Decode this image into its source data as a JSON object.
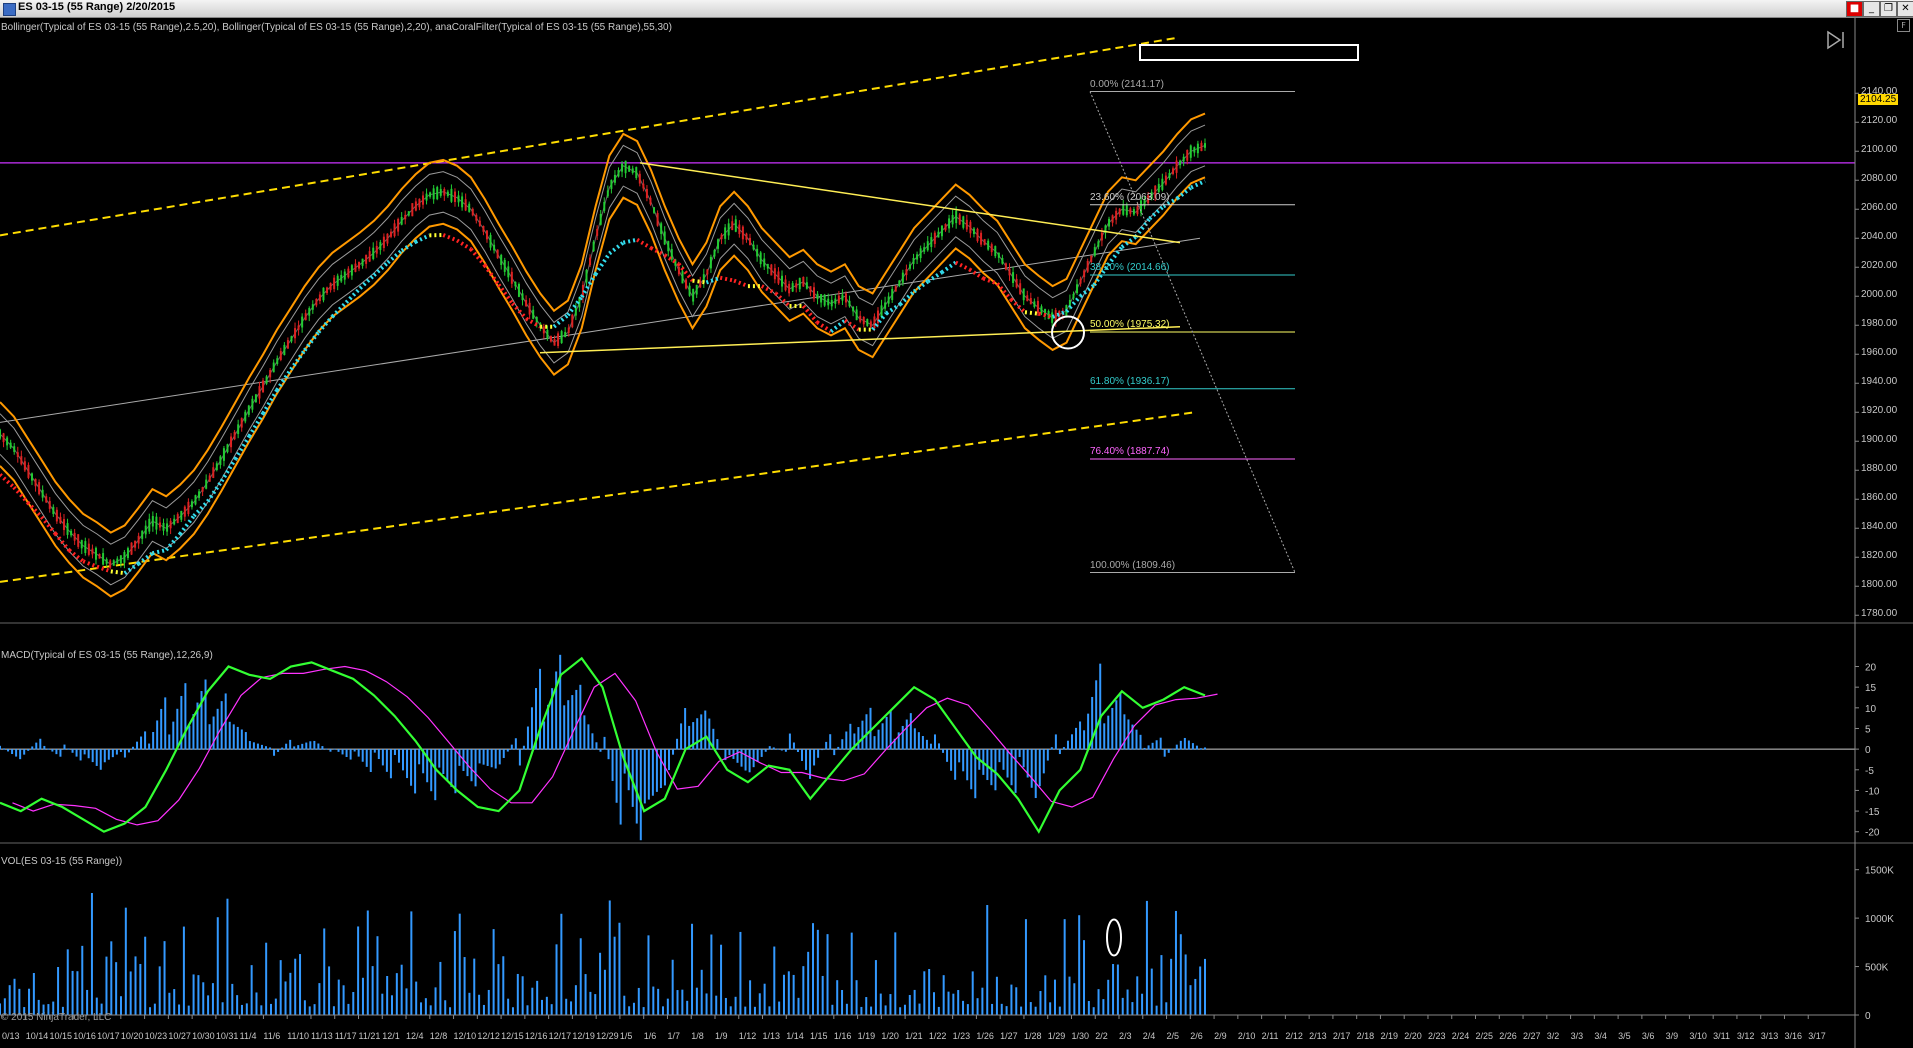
{
  "window": {
    "title": "ES 03-15 (55 Range)  2/20/2015",
    "buttons": [
      "_",
      "❐",
      "✕"
    ]
  },
  "colors": {
    "background": "#000000",
    "bollinger_outer": "#ff9900",
    "bollinger_inner": "#9a9a9a",
    "coral_up": "#33ddee",
    "coral_down": "#ff2222",
    "coral_neutral": "#ffff33",
    "channel": "#ffdd00",
    "triangle": "#ffee55",
    "purple_line": "#cc33ff",
    "candle_up": "#22cc33",
    "candle_down": "#dd2222",
    "macd_line": "#33ff33",
    "signal_line": "#ff33ff",
    "histogram": "#3399ff",
    "volume": "#3399ff"
  },
  "panels": {
    "price_label": "Bollinger(Typical of ES 03-15 (55 Range),2.5,20), Bollinger(Typical of ES 03-15 (55 Range),2,20), anaCoralFilter(Typical of ES 03-15 (55 Range),55,30)",
    "macd_label": "MACD(Typical of ES 03-15 (55 Range),12,26,9)",
    "volume_label": "VOL(ES 03-15 (55 Range))",
    "last_price": "2104.25",
    "copyright": "© 2015 NinjaTrader, LLC",
    "corner_box": "F"
  },
  "chart_data": {
    "type": "candlestick",
    "instrument": "ES 03-15 (55 Range)",
    "price_axis": {
      "ticks": [
        "2140.00",
        "2120.00",
        "2100.00",
        "2080.00",
        "2060.00",
        "2040.00",
        "2020.00",
        "2000.00",
        "1980.00",
        "1960.00",
        "1940.00",
        "1920.00",
        "1900.00",
        "1880.00",
        "1860.00",
        "1840.00",
        "1820.00",
        "1800.00",
        "1780.00"
      ],
      "range": [
        1765,
        2165
      ]
    },
    "macd_axis": {
      "ticks": [
        "20",
        "15",
        "10",
        "5",
        "0",
        "-5",
        "-10",
        "-15",
        "-20"
      ],
      "range": [
        -22,
        24
      ]
    },
    "volume_axis": {
      "ticks": [
        "1500K",
        "1000K",
        "500K",
        "0"
      ],
      "range": [
        0,
        1600
      ]
    },
    "x_labels": [
      "0/13",
      "10/14",
      "10/15",
      "10/16",
      "10/17",
      "10/20",
      "10/23",
      "10/27",
      "10/30",
      "10/31",
      "11/4",
      "11/6",
      "11/10",
      "11/13",
      "11/17",
      "11/21",
      "12/1",
      "12/4",
      "12/8",
      "12/10",
      "12/12",
      "12/15",
      "12/16",
      "12/17",
      "12/19",
      "12/29",
      "1/5",
      "1/6",
      "1/7",
      "1/8",
      "1/9",
      "1/12",
      "1/13",
      "1/14",
      "1/15",
      "1/16",
      "1/19",
      "1/20",
      "1/21",
      "1/22",
      "1/23",
      "1/26",
      "1/27",
      "1/28",
      "1/29",
      "1/30",
      "2/2",
      "2/3",
      "2/4",
      "2/5",
      "2/6",
      "2/9",
      "2/10",
      "2/11",
      "2/12",
      "2/13",
      "2/17",
      "2/18",
      "2/19",
      "2/20",
      "2/23",
      "2/24",
      "2/25",
      "2/26",
      "2/27",
      "3/2",
      "3/3",
      "3/4",
      "3/5",
      "3/6",
      "3/9",
      "3/10",
      "3/11",
      "3/12",
      "3/13",
      "3/16",
      "3/17"
    ],
    "price_path": [
      [
        0,
        1905
      ],
      [
        1,
        1895
      ],
      [
        2,
        1880
      ],
      [
        3,
        1865
      ],
      [
        4,
        1850
      ],
      [
        5,
        1838
      ],
      [
        6,
        1828
      ],
      [
        7,
        1822
      ],
      [
        8,
        1815
      ],
      [
        9,
        1820
      ],
      [
        10,
        1832
      ],
      [
        11,
        1845
      ],
      [
        12,
        1840
      ],
      [
        13,
        1848
      ],
      [
        14,
        1858
      ],
      [
        15,
        1872
      ],
      [
        16,
        1888
      ],
      [
        17,
        1905
      ],
      [
        18,
        1922
      ],
      [
        19,
        1938
      ],
      [
        20,
        1955
      ],
      [
        21,
        1970
      ],
      [
        22,
        1985
      ],
      [
        23,
        1998
      ],
      [
        24,
        2008
      ],
      [
        25,
        2015
      ],
      [
        26,
        2022
      ],
      [
        27,
        2030
      ],
      [
        28,
        2040
      ],
      [
        29,
        2052
      ],
      [
        30,
        2062
      ],
      [
        31,
        2070
      ],
      [
        32,
        2072
      ],
      [
        33,
        2068
      ],
      [
        34,
        2060
      ],
      [
        35,
        2045
      ],
      [
        36,
        2028
      ],
      [
        37,
        2012
      ],
      [
        38,
        1995
      ],
      [
        39,
        1980
      ],
      [
        40,
        1968
      ],
      [
        41,
        1975
      ],
      [
        42,
        2000
      ],
      [
        43,
        2040
      ],
      [
        44,
        2075
      ],
      [
        45,
        2090
      ],
      [
        46,
        2085
      ],
      [
        47,
        2065
      ],
      [
        48,
        2040
      ],
      [
        49,
        2018
      ],
      [
        50,
        2000
      ],
      [
        51,
        2015
      ],
      [
        52,
        2040
      ],
      [
        53,
        2050
      ],
      [
        54,
        2040
      ],
      [
        55,
        2025
      ],
      [
        56,
        2015
      ],
      [
        57,
        2005
      ],
      [
        58,
        2010
      ],
      [
        59,
        2000
      ],
      [
        60,
        1995
      ],
      [
        61,
        2000
      ],
      [
        62,
        1985
      ],
      [
        63,
        1980
      ],
      [
        64,
        1995
      ],
      [
        65,
        2010
      ],
      [
        66,
        2025
      ],
      [
        67,
        2035
      ],
      [
        68,
        2045
      ],
      [
        69,
        2055
      ],
      [
        70,
        2048
      ],
      [
        71,
        2038
      ],
      [
        72,
        2030
      ],
      [
        73,
        2015
      ],
      [
        74,
        2000
      ],
      [
        75,
        1992
      ],
      [
        76,
        1985
      ],
      [
        77,
        1990
      ],
      [
        78,
        2010
      ],
      [
        79,
        2030
      ],
      [
        80,
        2050
      ],
      [
        81,
        2060
      ],
      [
        82,
        2058
      ],
      [
        83,
        2068
      ],
      [
        84,
        2078
      ],
      [
        85,
        2090
      ],
      [
        86,
        2100
      ],
      [
        87,
        2104
      ]
    ],
    "macd_line": [
      [
        0,
        -13
      ],
      [
        1,
        -15
      ],
      [
        2,
        -12
      ],
      [
        3,
        -14
      ],
      [
        4,
        -17
      ],
      [
        5,
        -20
      ],
      [
        6,
        -18
      ],
      [
        7,
        -14
      ],
      [
        8,
        -5
      ],
      [
        9,
        5
      ],
      [
        10,
        14
      ],
      [
        11,
        20
      ],
      [
        12,
        18
      ],
      [
        13,
        17
      ],
      [
        14,
        20
      ],
      [
        15,
        21
      ],
      [
        16,
        19
      ],
      [
        17,
        17
      ],
      [
        18,
        13
      ],
      [
        19,
        8
      ],
      [
        20,
        2
      ],
      [
        21,
        -5
      ],
      [
        22,
        -10
      ],
      [
        23,
        -14
      ],
      [
        24,
        -15
      ],
      [
        25,
        -10
      ],
      [
        26,
        5
      ],
      [
        27,
        18
      ],
      [
        28,
        22
      ],
      [
        29,
        15
      ],
      [
        30,
        -2
      ],
      [
        31,
        -15
      ],
      [
        32,
        -12
      ],
      [
        33,
        0
      ],
      [
        34,
        3
      ],
      [
        35,
        -5
      ],
      [
        36,
        -8
      ],
      [
        37,
        -4
      ],
      [
        38,
        -5
      ],
      [
        39,
        -12
      ],
      [
        40,
        -6
      ],
      [
        41,
        0
      ],
      [
        42,
        5
      ],
      [
        43,
        10
      ],
      [
        44,
        15
      ],
      [
        45,
        12
      ],
      [
        46,
        5
      ],
      [
        47,
        -2
      ],
      [
        48,
        -6
      ],
      [
        49,
        -12
      ],
      [
        50,
        -20
      ],
      [
        51,
        -10
      ],
      [
        52,
        -5
      ],
      [
        53,
        8
      ],
      [
        54,
        14
      ],
      [
        55,
        10
      ],
      [
        56,
        12
      ],
      [
        57,
        15
      ],
      [
        58,
        13
      ]
    ],
    "fibonacci": [
      {
        "label": "0.00% (2141.17)",
        "price": 2141.17,
        "color": "#aaaaaa"
      },
      {
        "label": "23.60% (2063.09)",
        "price": 2063.09,
        "color": "#cccccc"
      },
      {
        "label": "38.20% (2014.66)",
        "price": 2014.66,
        "color": "#33cccc"
      },
      {
        "label": "50.00% (1975.32)",
        "price": 1975.32,
        "color": "#ffff66"
      },
      {
        "label": "61.80% (1936.17)",
        "price": 1936.17,
        "color": "#33cccc"
      },
      {
        "label": "76.40% (1887.74)",
        "price": 1887.74,
        "color": "#ff66ff"
      },
      {
        "label": "100.00% (1809.46)",
        "price": 1809.46,
        "color": "#aaaaaa"
      }
    ],
    "horizontal_line": 2092,
    "channel_upper": [
      [
        1818,
        2175
      ],
      [
        1163,
        2148
      ]
    ],
    "channel_lower": [
      [
        1770,
        1810
      ],
      [
        1184,
        1920
      ]
    ],
    "triangle_upper": [
      [
        2092,
        2040
      ],
      [
        1185,
        2037
      ]
    ],
    "triangle_lower": [
      [
        1961,
        1965
      ],
      [
        1180,
        1979
      ]
    ]
  }
}
